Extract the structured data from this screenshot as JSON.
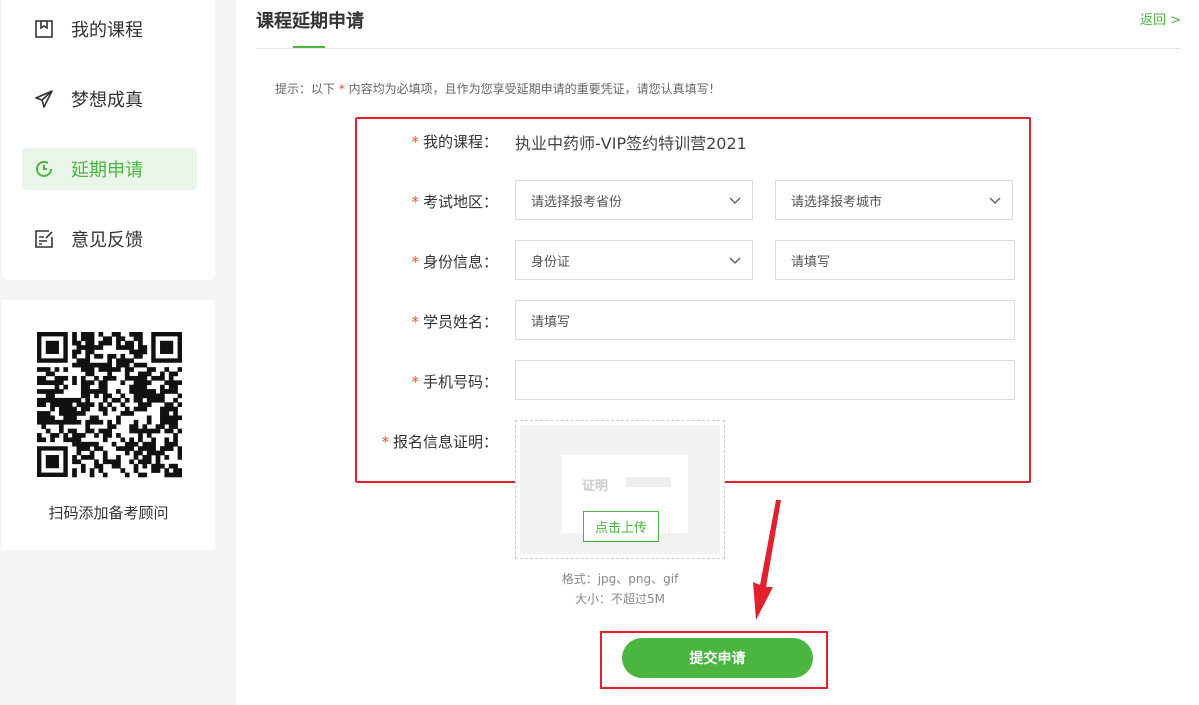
{
  "sidebar": {
    "items": [
      {
        "label": "我的课程",
        "icon": "bookmark-icon",
        "active": false
      },
      {
        "label": "梦想成真",
        "icon": "paper-plane-icon",
        "active": false
      },
      {
        "label": "延期申请",
        "icon": "clock-icon",
        "active": true
      },
      {
        "label": "意见反馈",
        "icon": "feedback-edit-icon",
        "active": false
      }
    ],
    "qr": {
      "icon": "qr-code-image",
      "caption": "扫码添加备考顾问"
    }
  },
  "header": {
    "title": "课程延期申请",
    "back_label": "返回 >"
  },
  "tip": {
    "prefix": "提示：以下 ",
    "star": "*",
    "suffix": " 内容均为必填项，且作为您享受延期申请的重要凭证，请您认真填写！"
  },
  "form": {
    "required_mark": "*",
    "course": {
      "label": "我的课程：",
      "value": "执业中药师-VIP签约特训营2021"
    },
    "region": {
      "label": "考试地区：",
      "province_value": "请选择报考省份",
      "city_value": "请选择报考城市"
    },
    "identity": {
      "label": "身份信息：",
      "type_value": "身份证",
      "number_placeholder": "请填写"
    },
    "name": {
      "label": "学员姓名：",
      "placeholder": "请填写"
    },
    "phone": {
      "label": "手机号码：",
      "value": ""
    },
    "proof": {
      "label": "报名信息证明：",
      "doc_word": "证明",
      "upload_label": "点击上传",
      "format_note": "格式：jpg、png、gif",
      "size_note": "大小：不超过5M"
    }
  },
  "submit": {
    "label": "提交申请"
  },
  "colors": {
    "accent": "#4ab640",
    "highlight": "#e4202e",
    "required": "#e8532b"
  }
}
